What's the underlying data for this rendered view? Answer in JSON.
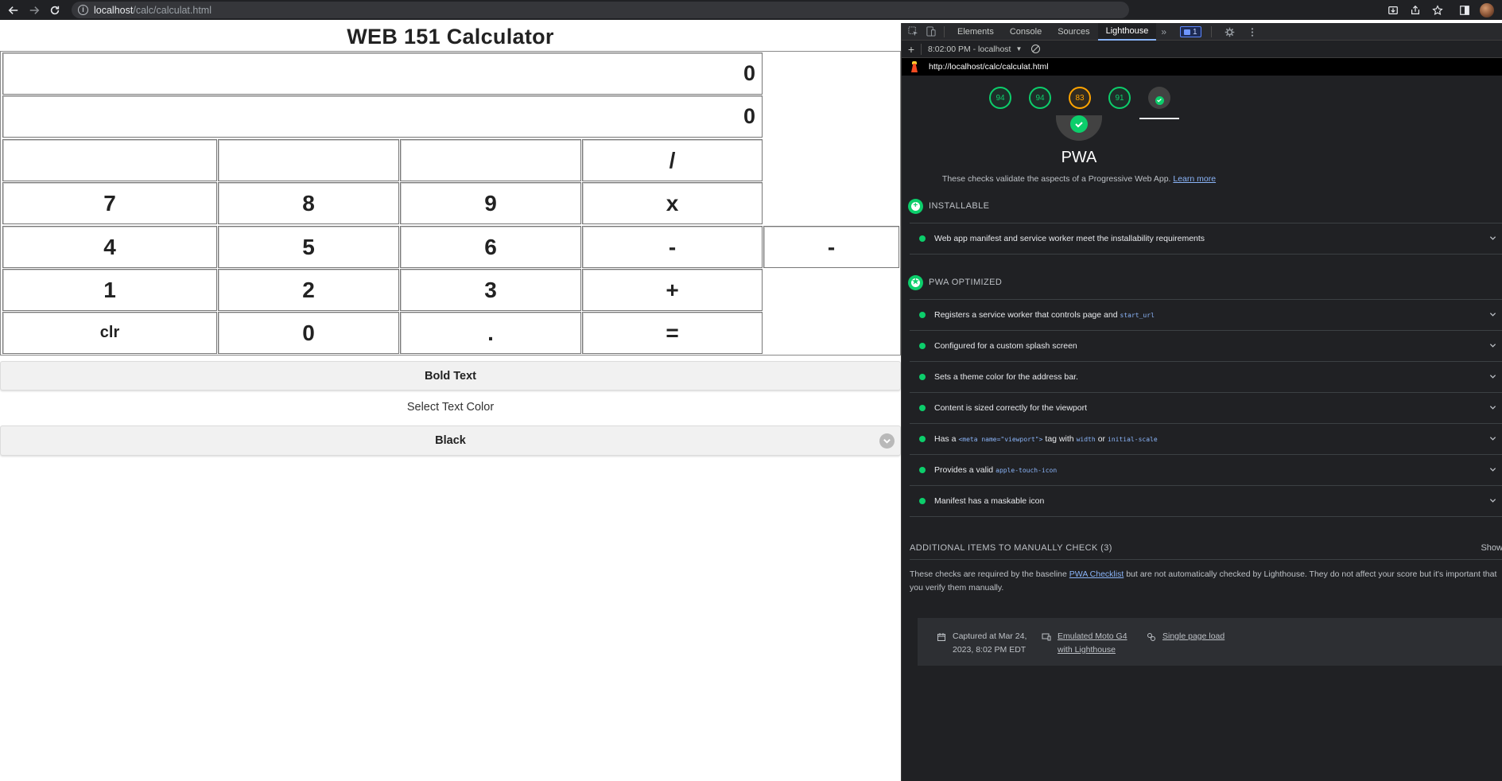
{
  "browser": {
    "url_host": "localhost",
    "url_path": "/calc/calculat.html"
  },
  "calculator": {
    "title": "WEB 151 Calculator",
    "display_top": "0",
    "display_bottom": "0",
    "keys": {
      "r0c3": "/",
      "r1c0": "7",
      "r1c1": "8",
      "r1c2": "9",
      "r1c3": "x",
      "r2c0": "4",
      "r2c1": "5",
      "r2c2": "6",
      "r2c3": "-",
      "r2c4": "-",
      "r3c0": "1",
      "r3c1": "2",
      "r3c2": "3",
      "r3c3": "+",
      "r4c0": "clr",
      "r4c1": "0",
      "r4c2": ".",
      "r4c3": "="
    },
    "bold_button": "Bold Text",
    "color_label": "Select Text Color",
    "color_selected": "Black"
  },
  "devtools": {
    "tabs": [
      "Elements",
      "Console",
      "Sources",
      "Lighthouse"
    ],
    "active_tab": "Lighthouse",
    "message_count": "1",
    "report_time": "8:02:00 PM - localhost",
    "report_url": "http://localhost/calc/calculat.html",
    "scores": [
      "94",
      "94",
      "83",
      "91"
    ],
    "score_colors": [
      "#0cce6b",
      "#0cce6b",
      "#ffa400",
      "#0cce6b"
    ],
    "pwa": {
      "title": "PWA",
      "description": "These checks validate the aspects of a Progressive Web App.",
      "learn_more": "Learn more",
      "installable_heading": "INSTALLABLE",
      "installable_audits": [
        "Web app manifest and service worker meet the installability requirements"
      ],
      "optimized_heading": "PWA OPTIMIZED",
      "optimized_audits": {
        "a1_pre": "Registers a service worker that controls page and",
        "a1_code": "start_url",
        "a2": "Configured for a custom splash screen",
        "a3": "Sets a theme color for the address bar.",
        "a4": "Content is sized correctly for the viewport",
        "a5_pre": "Has a",
        "a5_code1": "<meta name=\"viewport\">",
        "a5_mid": "tag with",
        "a5_code2": "width",
        "a5_or": "or",
        "a5_code3": "initial-scale",
        "a6_pre": "Provides a valid",
        "a6_code": "apple-touch-icon",
        "a7": "Manifest has a maskable icon"
      },
      "manual_heading": "ADDITIONAL ITEMS TO MANUALLY CHECK (3)",
      "manual_show": "Show",
      "manual_desc_1": "These checks are required by the baseline",
      "manual_link": "PWA Checklist",
      "manual_desc_2": "but are not automatically checked by Lighthouse. They do not affect your score but it's important that you verify them manually.",
      "footer_captured": "Captured at Mar 24,",
      "footer_captured_2": "2023, 8:02 PM EDT",
      "footer_emulated": "Emulated Moto G4",
      "footer_emulated_2": "with Lighthouse",
      "footer_load": "Single page load"
    }
  }
}
